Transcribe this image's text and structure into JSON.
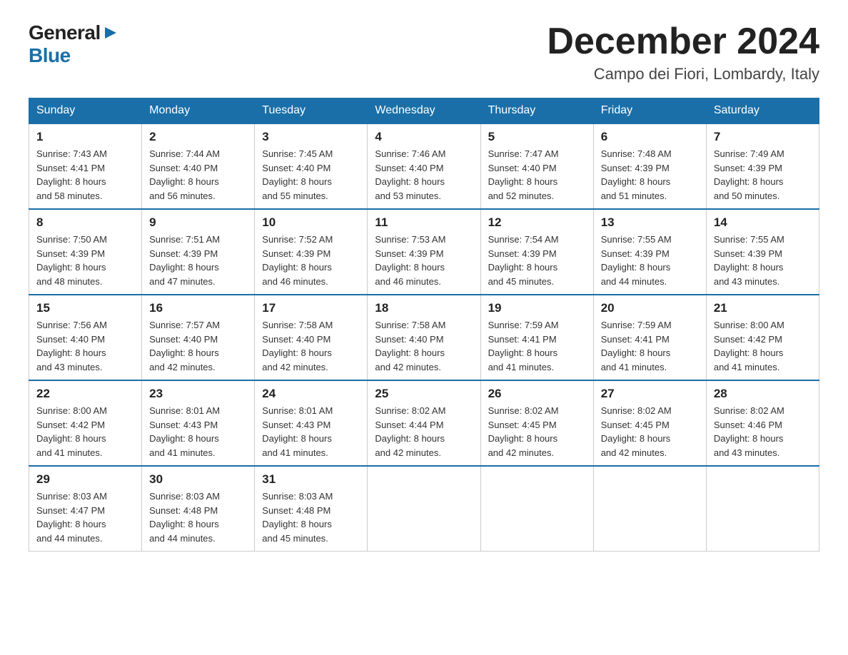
{
  "logo": {
    "general": "General",
    "blue": "Blue",
    "arrow": "▶"
  },
  "title": "December 2024",
  "location": "Campo dei Fiori, Lombardy, Italy",
  "days_of_week": [
    "Sunday",
    "Monday",
    "Tuesday",
    "Wednesday",
    "Thursday",
    "Friday",
    "Saturday"
  ],
  "weeks": [
    [
      {
        "day": "1",
        "sunrise": "7:43 AM",
        "sunset": "4:41 PM",
        "daylight": "8 hours and 58 minutes."
      },
      {
        "day": "2",
        "sunrise": "7:44 AM",
        "sunset": "4:40 PM",
        "daylight": "8 hours and 56 minutes."
      },
      {
        "day": "3",
        "sunrise": "7:45 AM",
        "sunset": "4:40 PM",
        "daylight": "8 hours and 55 minutes."
      },
      {
        "day": "4",
        "sunrise": "7:46 AM",
        "sunset": "4:40 PM",
        "daylight": "8 hours and 53 minutes."
      },
      {
        "day": "5",
        "sunrise": "7:47 AM",
        "sunset": "4:40 PM",
        "daylight": "8 hours and 52 minutes."
      },
      {
        "day": "6",
        "sunrise": "7:48 AM",
        "sunset": "4:39 PM",
        "daylight": "8 hours and 51 minutes."
      },
      {
        "day": "7",
        "sunrise": "7:49 AM",
        "sunset": "4:39 PM",
        "daylight": "8 hours and 50 minutes."
      }
    ],
    [
      {
        "day": "8",
        "sunrise": "7:50 AM",
        "sunset": "4:39 PM",
        "daylight": "8 hours and 48 minutes."
      },
      {
        "day": "9",
        "sunrise": "7:51 AM",
        "sunset": "4:39 PM",
        "daylight": "8 hours and 47 minutes."
      },
      {
        "day": "10",
        "sunrise": "7:52 AM",
        "sunset": "4:39 PM",
        "daylight": "8 hours and 46 minutes."
      },
      {
        "day": "11",
        "sunrise": "7:53 AM",
        "sunset": "4:39 PM",
        "daylight": "8 hours and 46 minutes."
      },
      {
        "day": "12",
        "sunrise": "7:54 AM",
        "sunset": "4:39 PM",
        "daylight": "8 hours and 45 minutes."
      },
      {
        "day": "13",
        "sunrise": "7:55 AM",
        "sunset": "4:39 PM",
        "daylight": "8 hours and 44 minutes."
      },
      {
        "day": "14",
        "sunrise": "7:55 AM",
        "sunset": "4:39 PM",
        "daylight": "8 hours and 43 minutes."
      }
    ],
    [
      {
        "day": "15",
        "sunrise": "7:56 AM",
        "sunset": "4:40 PM",
        "daylight": "8 hours and 43 minutes."
      },
      {
        "day": "16",
        "sunrise": "7:57 AM",
        "sunset": "4:40 PM",
        "daylight": "8 hours and 42 minutes."
      },
      {
        "day": "17",
        "sunrise": "7:58 AM",
        "sunset": "4:40 PM",
        "daylight": "8 hours and 42 minutes."
      },
      {
        "day": "18",
        "sunrise": "7:58 AM",
        "sunset": "4:40 PM",
        "daylight": "8 hours and 42 minutes."
      },
      {
        "day": "19",
        "sunrise": "7:59 AM",
        "sunset": "4:41 PM",
        "daylight": "8 hours and 41 minutes."
      },
      {
        "day": "20",
        "sunrise": "7:59 AM",
        "sunset": "4:41 PM",
        "daylight": "8 hours and 41 minutes."
      },
      {
        "day": "21",
        "sunrise": "8:00 AM",
        "sunset": "4:42 PM",
        "daylight": "8 hours and 41 minutes."
      }
    ],
    [
      {
        "day": "22",
        "sunrise": "8:00 AM",
        "sunset": "4:42 PM",
        "daylight": "8 hours and 41 minutes."
      },
      {
        "day": "23",
        "sunrise": "8:01 AM",
        "sunset": "4:43 PM",
        "daylight": "8 hours and 41 minutes."
      },
      {
        "day": "24",
        "sunrise": "8:01 AM",
        "sunset": "4:43 PM",
        "daylight": "8 hours and 41 minutes."
      },
      {
        "day": "25",
        "sunrise": "8:02 AM",
        "sunset": "4:44 PM",
        "daylight": "8 hours and 42 minutes."
      },
      {
        "day": "26",
        "sunrise": "8:02 AM",
        "sunset": "4:45 PM",
        "daylight": "8 hours and 42 minutes."
      },
      {
        "day": "27",
        "sunrise": "8:02 AM",
        "sunset": "4:45 PM",
        "daylight": "8 hours and 42 minutes."
      },
      {
        "day": "28",
        "sunrise": "8:02 AM",
        "sunset": "4:46 PM",
        "daylight": "8 hours and 43 minutes."
      }
    ],
    [
      {
        "day": "29",
        "sunrise": "8:03 AM",
        "sunset": "4:47 PM",
        "daylight": "8 hours and 44 minutes."
      },
      {
        "day": "30",
        "sunrise": "8:03 AM",
        "sunset": "4:48 PM",
        "daylight": "8 hours and 44 minutes."
      },
      {
        "day": "31",
        "sunrise": "8:03 AM",
        "sunset": "4:48 PM",
        "daylight": "8 hours and 45 minutes."
      },
      null,
      null,
      null,
      null
    ]
  ]
}
